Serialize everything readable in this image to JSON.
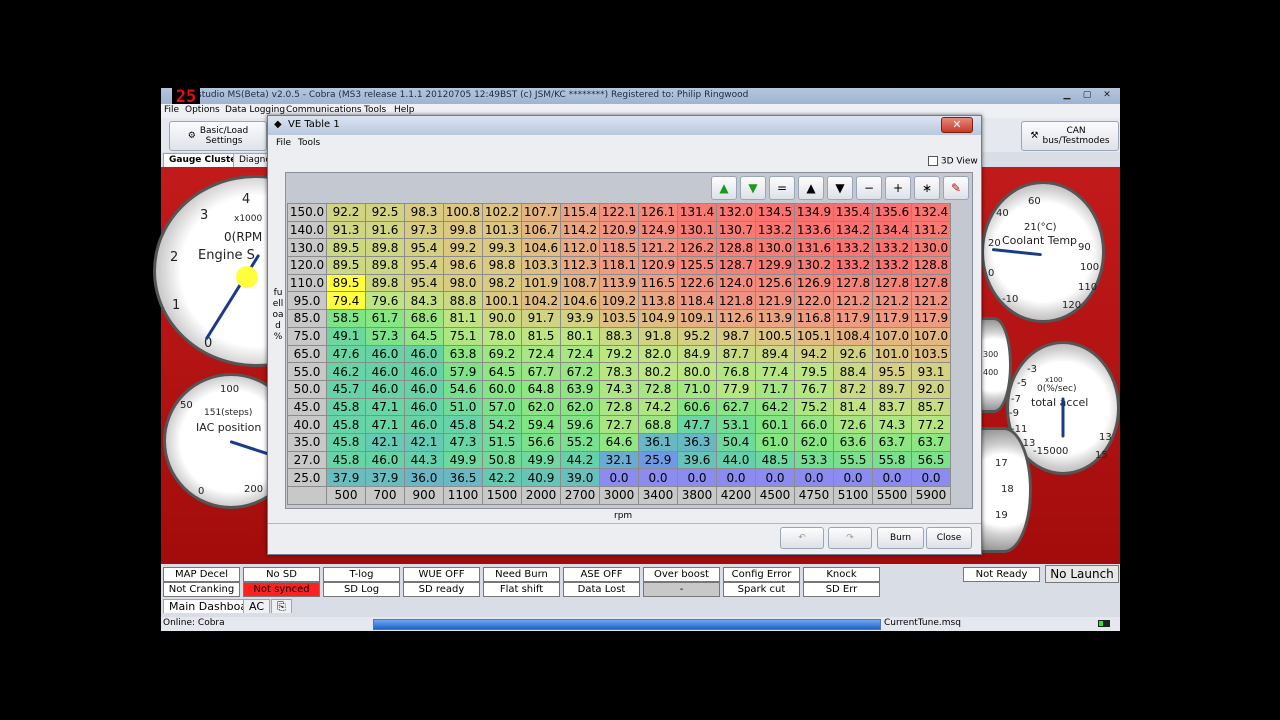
{
  "overlay_badge": "25",
  "window": {
    "title": "studio MS(Beta) v2.0.5 - Cobra (MS3 release 1.1.1  20120705 12:49BST (c) JSM/KC ********) Registered to: Philip Ringwood"
  },
  "menu": [
    "File",
    "Options",
    "Data Logging",
    "Communications",
    "Tools",
    "Help"
  ],
  "toolbar": {
    "basic_load": "Basic/Load\nSettings",
    "can": "CAN\nbus/Testmodes"
  },
  "tabs": [
    "Gauge Cluster",
    "Diagno"
  ],
  "gauges": {
    "rpm": {
      "label": "Engine S",
      "value": "0(RPM",
      "unit": "x1000",
      "ticks": [
        "3",
        "4",
        "2",
        "1",
        "0"
      ]
    },
    "iac": {
      "label": "IAC position",
      "value": "151(steps)",
      "ticks": [
        "100",
        "50",
        "0",
        "200"
      ]
    },
    "coolant": {
      "label": "Coolant Temp",
      "value": "21(°C)",
      "ticks": [
        "60",
        "40",
        "20",
        "0",
        "-10",
        "90",
        "100",
        "110",
        "120"
      ]
    },
    "accel": {
      "label": "total accel",
      "value": "0(%/sec)",
      "unit": "x100",
      "ticks": [
        "-3",
        "-5",
        "-7",
        "-9",
        "-11",
        "-13",
        "-15000",
        "13",
        "15"
      ]
    },
    "partial_labels": [
      "300",
      "400",
      "17",
      "18",
      "19"
    ]
  },
  "dialog": {
    "title": "VE Table 1",
    "menu": [
      "File",
      "Tools"
    ],
    "view_3d_label": "3D View",
    "y_axis_label": "fuelload %",
    "x_axis_label": "rpm",
    "burn_label": "Burn",
    "close_label": "Close",
    "toolbar_icons": [
      "up-green-icon",
      "down-green-icon",
      "equals-icon",
      "increase-up-icon",
      "decrease-down-icon",
      "minus-icon",
      "plus-icon",
      "multiply-icon",
      "pencil-icon"
    ],
    "toolbar_symbols": [
      "▲",
      "▼",
      "=",
      "▲",
      "▼",
      "−",
      "+",
      "∗",
      "✎"
    ]
  },
  "ve_table": {
    "rpm": [
      "500",
      "700",
      "900",
      "1100",
      "1500",
      "2000",
      "2700",
      "3000",
      "3400",
      "3800",
      "4200",
      "4500",
      "4750",
      "5100",
      "5500",
      "5900"
    ],
    "load": [
      "150.0",
      "140.0",
      "130.0",
      "120.0",
      "110.0",
      "95.0",
      "85.0",
      "75.0",
      "65.0",
      "55.0",
      "50.0",
      "45.0",
      "40.0",
      "35.0",
      "27.0",
      "25.0"
    ],
    "values": [
      [
        "92.2",
        "92.5",
        "98.3",
        "100.8",
        "102.2",
        "107.7",
        "115.4",
        "122.1",
        "126.1",
        "131.4",
        "132.0",
        "134.5",
        "134.9",
        "135.4",
        "135.6",
        "132.4"
      ],
      [
        "91.3",
        "91.6",
        "97.3",
        "99.8",
        "101.3",
        "106.7",
        "114.2",
        "120.9",
        "124.9",
        "130.1",
        "130.7",
        "133.2",
        "133.6",
        "134.2",
        "134.4",
        "131.2"
      ],
      [
        "89.5",
        "89.8",
        "95.4",
        "99.2",
        "99.3",
        "104.6",
        "112.0",
        "118.5",
        "121.2",
        "126.2",
        "128.8",
        "130.0",
        "131.6",
        "133.2",
        "133.2",
        "130.0"
      ],
      [
        "89.5",
        "89.8",
        "95.4",
        "98.6",
        "98.8",
        "103.3",
        "112.3",
        "118.1",
        "120.9",
        "125.5",
        "128.7",
        "129.9",
        "130.2",
        "133.2",
        "133.2",
        "128.8"
      ],
      [
        "89.5",
        "89.8",
        "95.4",
        "98.0",
        "98.2",
        "101.9",
        "108.7",
        "113.9",
        "116.5",
        "122.6",
        "124.0",
        "125.6",
        "126.9",
        "127.8",
        "127.8",
        "127.8"
      ],
      [
        "79.4",
        "79.6",
        "84.3",
        "88.8",
        "100.1",
        "104.2",
        "104.6",
        "109.2",
        "113.8",
        "118.4",
        "121.8",
        "121.9",
        "122.0",
        "121.2",
        "121.2",
        "121.2"
      ],
      [
        "58.5",
        "61.7",
        "68.6",
        "81.1",
        "90.0",
        "91.7",
        "93.9",
        "103.5",
        "104.9",
        "109.1",
        "112.6",
        "113.9",
        "116.8",
        "117.9",
        "117.9",
        "117.9"
      ],
      [
        "49.1",
        "57.3",
        "64.5",
        "75.1",
        "78.0",
        "81.5",
        "80.1",
        "88.3",
        "91.8",
        "95.2",
        "98.7",
        "100.5",
        "105.1",
        "108.4",
        "107.0",
        "107.0"
      ],
      [
        "47.6",
        "46.0",
        "46.0",
        "63.8",
        "69.2",
        "72.4",
        "72.4",
        "79.2",
        "82.0",
        "84.9",
        "87.7",
        "89.4",
        "94.2",
        "92.6",
        "101.0",
        "103.5"
      ],
      [
        "46.2",
        "46.0",
        "46.0",
        "57.9",
        "64.5",
        "67.7",
        "67.2",
        "78.3",
        "80.2",
        "80.0",
        "76.8",
        "77.4",
        "79.5",
        "88.4",
        "95.5",
        "93.1"
      ],
      [
        "45.7",
        "46.0",
        "46.0",
        "54.6",
        "60.0",
        "64.8",
        "63.9",
        "74.3",
        "72.8",
        "71.0",
        "77.9",
        "71.7",
        "76.7",
        "87.2",
        "89.7",
        "92.0"
      ],
      [
        "45.8",
        "47.1",
        "46.0",
        "51.0",
        "57.0",
        "62.0",
        "62.0",
        "72.8",
        "74.2",
        "60.6",
        "62.7",
        "64.2",
        "75.2",
        "81.4",
        "83.7",
        "85.7"
      ],
      [
        "45.8",
        "47.1",
        "46.0",
        "45.8",
        "54.2",
        "59.4",
        "59.6",
        "72.7",
        "68.8",
        "47.7",
        "53.1",
        "60.1",
        "66.0",
        "72.6",
        "74.3",
        "77.2"
      ],
      [
        "45.8",
        "42.1",
        "42.1",
        "47.3",
        "51.5",
        "56.6",
        "55.2",
        "64.6",
        "36.1",
        "36.3",
        "50.4",
        "61.0",
        "62.0",
        "63.6",
        "63.7",
        "63.7"
      ],
      [
        "45.8",
        "46.0",
        "44.3",
        "49.9",
        "50.8",
        "49.9",
        "44.2",
        "32.1",
        "25.9",
        "39.6",
        "44.0",
        "48.5",
        "53.3",
        "55.5",
        "55.8",
        "56.5"
      ],
      [
        "37.9",
        "37.9",
        "36.0",
        "36.5",
        "42.2",
        "40.9",
        "39.0",
        "0.0",
        "0.0",
        "0.0",
        "0.0",
        "0.0",
        "0.0",
        "0.0",
        "0.0",
        "0.0"
      ]
    ],
    "highlight_cells": [
      [
        4,
        0
      ],
      [
        5,
        0
      ]
    ],
    "highlight_color": "#ffff40"
  },
  "status_buttons": {
    "row1": [
      "MAP Decel",
      "No SD",
      "T-log",
      "WUE OFF",
      "Need Burn",
      "ASE OFF",
      "Over boost",
      "Config Error",
      "Knock"
    ],
    "row2": [
      "Not Cranking",
      "Not synced",
      "SD Log",
      "SD ready",
      "Flat shift",
      "Data Lost",
      "-",
      "Spark cut",
      "SD Err"
    ],
    "not_ready": "Not Ready",
    "no_launch": "No Launch",
    "colors": {
      "not_synced": "#ff2020",
      "dash_bg": "#b01515"
    }
  },
  "bottom_tabs": [
    "Main Dashboard",
    "AC"
  ],
  "statusbar": {
    "online": "Online: Cobra",
    "tune": "CurrentTune.msq"
  }
}
